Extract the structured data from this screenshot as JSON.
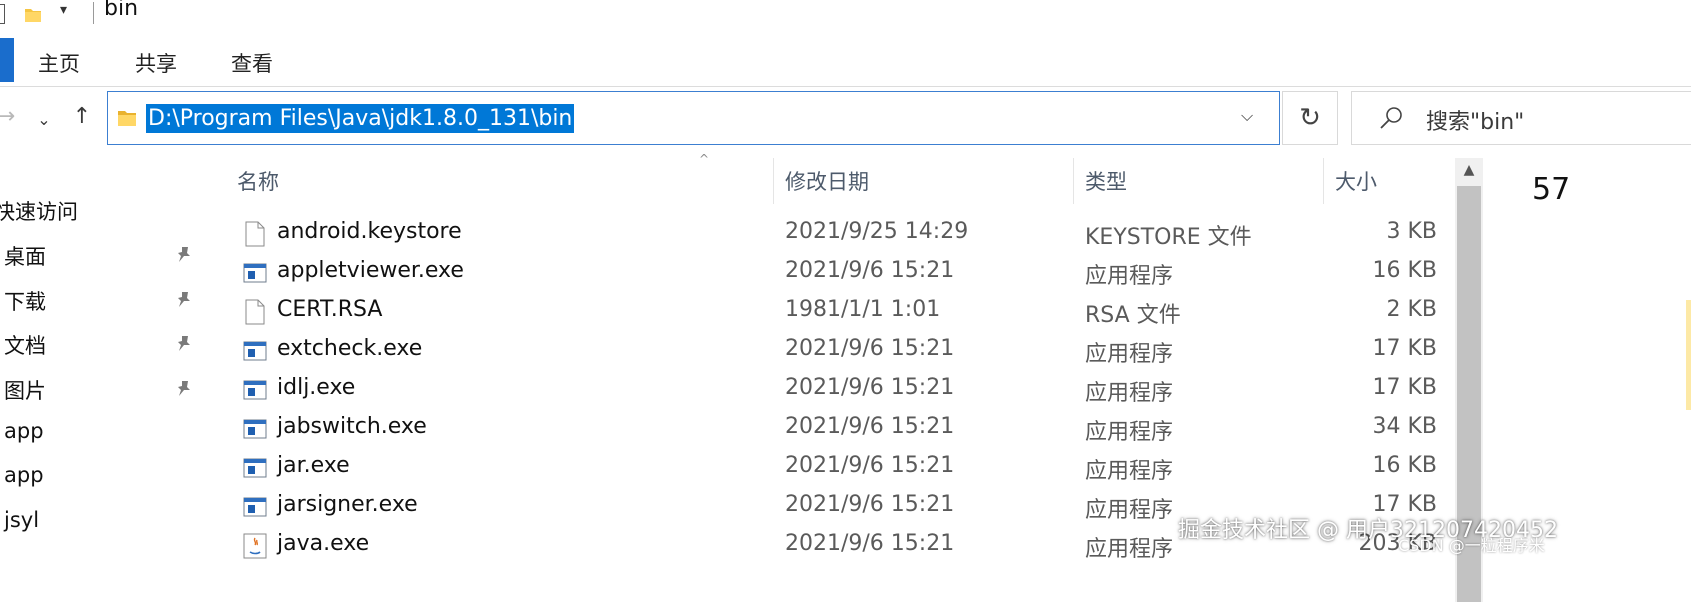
{
  "window": {
    "title": "bin"
  },
  "ribbon": {
    "tabs": [
      "主页",
      "共享",
      "查看"
    ]
  },
  "address": {
    "path": "D:\\Program Files\\Java\\jdk1.8.0_131\\bin"
  },
  "search": {
    "placeholder": "搜索\"bin\""
  },
  "navpane": {
    "items": [
      {
        "label": "快速访问",
        "pinned": false
      },
      {
        "label": "桌面",
        "pinned": true
      },
      {
        "label": "下载",
        "pinned": true
      },
      {
        "label": "文档",
        "pinned": true
      },
      {
        "label": "图片",
        "pinned": true
      },
      {
        "label": "app",
        "pinned": false
      },
      {
        "label": "app",
        "pinned": false
      },
      {
        "label": "jsyl",
        "pinned": false
      }
    ]
  },
  "columns": {
    "name": "名称",
    "date": "修改日期",
    "type": "类型",
    "size": "大小"
  },
  "files": [
    {
      "name": "android.keystore",
      "date": "2021/9/25 14:29",
      "type": "KEYSTORE 文件",
      "size": "3 KB",
      "icon": "blank-file-icon"
    },
    {
      "name": "appletviewer.exe",
      "date": "2021/9/6 15:21",
      "type": "应用程序",
      "size": "16 KB",
      "icon": "exe-icon"
    },
    {
      "name": "CERT.RSA",
      "date": "1981/1/1 1:01",
      "type": "RSA 文件",
      "size": "2 KB",
      "icon": "blank-file-icon"
    },
    {
      "name": "extcheck.exe",
      "date": "2021/9/6 15:21",
      "type": "应用程序",
      "size": "17 KB",
      "icon": "exe-icon"
    },
    {
      "name": "idlj.exe",
      "date": "2021/9/6 15:21",
      "type": "应用程序",
      "size": "17 KB",
      "icon": "exe-icon"
    },
    {
      "name": "jabswitch.exe",
      "date": "2021/9/6 15:21",
      "type": "应用程序",
      "size": "34 KB",
      "icon": "exe-icon"
    },
    {
      "name": "jar.exe",
      "date": "2021/9/6 15:21",
      "type": "应用程序",
      "size": "16 KB",
      "icon": "exe-icon"
    },
    {
      "name": "jarsigner.exe",
      "date": "2021/9/6 15:21",
      "type": "应用程序",
      "size": "17 KB",
      "icon": "exe-icon"
    },
    {
      "name": "java.exe",
      "date": "2021/9/6 15:21",
      "type": "应用程序",
      "size": "203 KB",
      "icon": "java-icon"
    }
  ],
  "details": {
    "count": "57"
  },
  "watermark": {
    "text": "掘金技术社区 @ 用户321207420452",
    "subtext": "CSDN @一粒程序米"
  },
  "colors": {
    "accent": "#0078d7",
    "selection": "#0078d7"
  }
}
